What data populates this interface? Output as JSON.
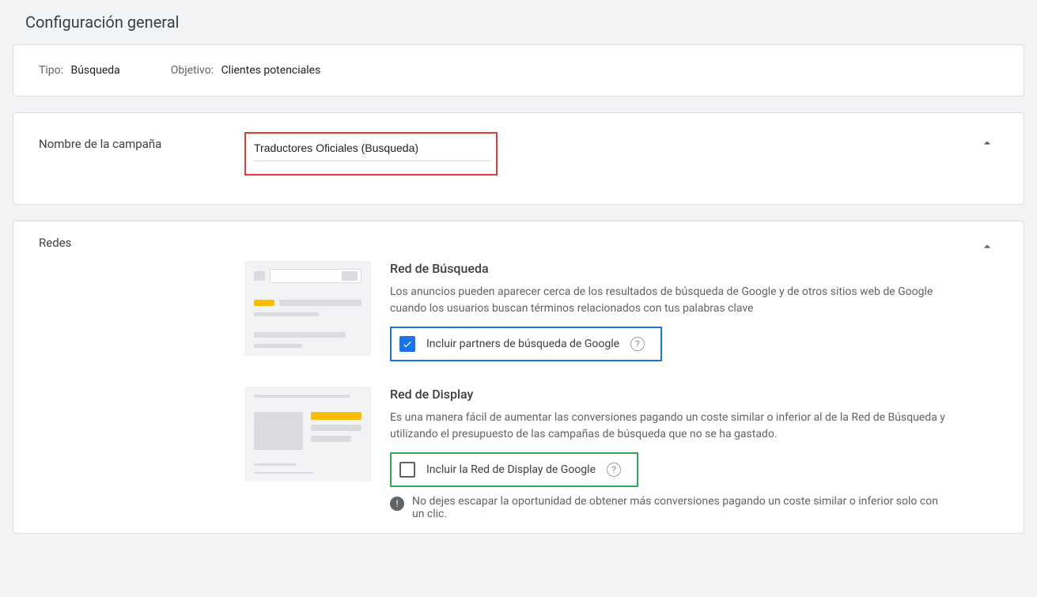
{
  "page_title": "Configuración general",
  "summary": {
    "type_label": "Tipo:",
    "type_value": "Búsqueda",
    "objective_label": "Objetivo:",
    "objective_value": "Clientes potenciales"
  },
  "campaign_name": {
    "section_label": "Nombre de la campaña",
    "value": "Traductores Oficiales (Busqueda)"
  },
  "networks": {
    "section_label": "Redes",
    "search": {
      "title": "Red de Búsqueda",
      "desc": "Los anuncios pueden aparecer cerca de los resultados de búsqueda de Google y de otros sitios web de Google cuando los usuarios buscan términos relacionados con tus palabras clave",
      "checkbox_label": "Incluir partners de búsqueda de Google",
      "checked": true
    },
    "display": {
      "title": "Red de Display",
      "desc": "Es una manera fácil de aumentar las conversiones pagando un coste similar o inferior al de la Red de Búsqueda y utilizando el presupuesto de las campañas de búsqueda que no se ha gastado.",
      "checkbox_label": "Incluir la Red de Display de Google",
      "checked": false,
      "note": "No dejes escapar la oportunidad de obtener más conversiones pagando un coste similar o inferior solo con un clic."
    }
  }
}
